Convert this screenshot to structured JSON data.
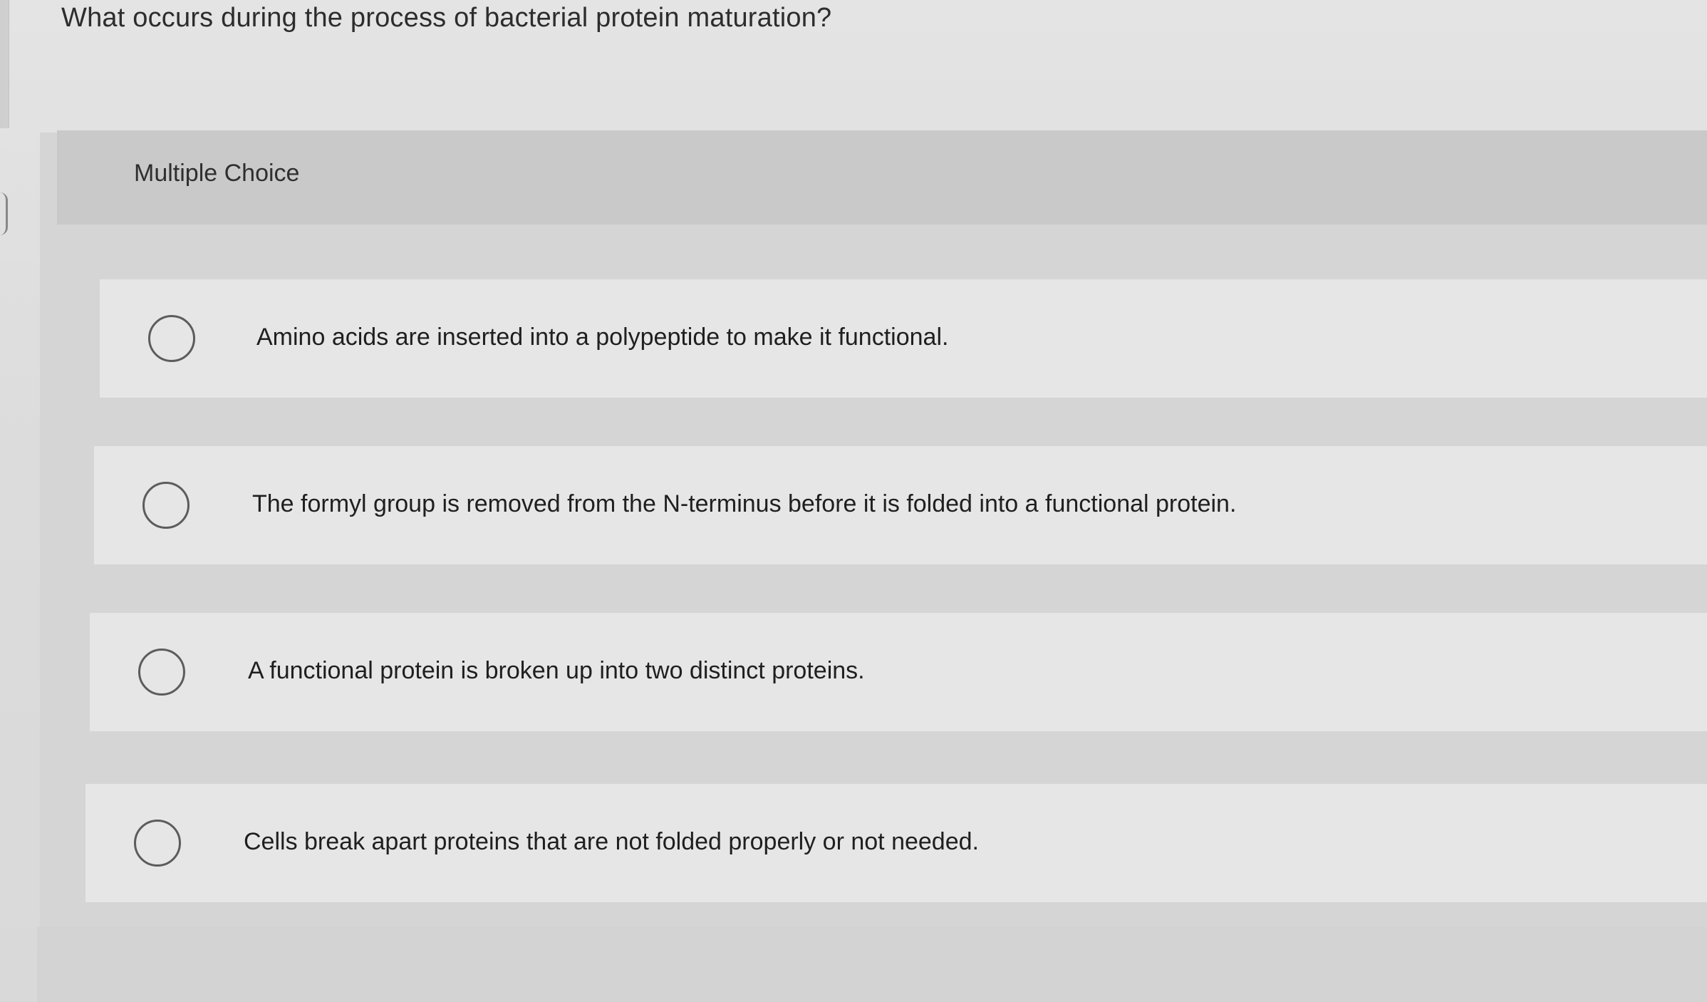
{
  "question": {
    "text": "What occurs during the process of bacterial protein maturation?"
  },
  "panel": {
    "title": "Multiple Choice"
  },
  "options": [
    {
      "label": "Amino acids are inserted into a polypeptide to make it functional.",
      "selected": false
    },
    {
      "label": "The formyl group is removed from the N-terminus before it is folded into a functional protein.",
      "selected": false
    },
    {
      "label": "A functional protein is broken up into two distinct proteins.",
      "selected": false
    },
    {
      "label": "Cells break apart proteins that are not folded properly or not needed.",
      "selected": false
    }
  ],
  "icons": {
    "radio": "radio-button-unselected-icon"
  },
  "colors": {
    "background": "#dcdcdc",
    "panel_header": "#c9c9c9",
    "option_background": "#e6e6e6",
    "radio_border": "#5c5c5c",
    "text": "#222222"
  }
}
